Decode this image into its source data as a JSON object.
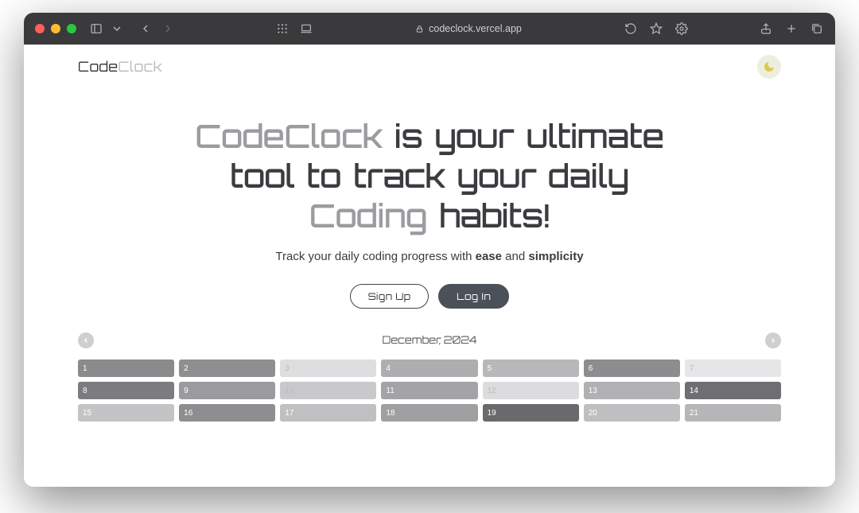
{
  "browser": {
    "url": "codeclock.vercel.app"
  },
  "site": {
    "logo_a": "Code",
    "logo_b": "Clock"
  },
  "hero": {
    "h_part1": "CodeClock",
    "h_part2": " is your ultimate tool to track your daily ",
    "h_part3": "Coding",
    "h_part4": " habits!",
    "sub_a": "Track your daily coding progress with ",
    "sub_b": "ease",
    "sub_c": " and ",
    "sub_d": "simplicity",
    "signup": "Sign Up",
    "login": "Log In"
  },
  "calendar": {
    "title": "December, 2024",
    "cells": [
      {
        "n": "1",
        "bg": "#8b8b8e"
      },
      {
        "n": "2",
        "bg": "#8f8f92"
      },
      {
        "n": "3",
        "bg": "#dedee0"
      },
      {
        "n": "4",
        "bg": "#aeaeb1"
      },
      {
        "n": "5",
        "bg": "#b8b8ba"
      },
      {
        "n": "6",
        "bg": "#8d8d90"
      },
      {
        "n": "7",
        "bg": "#e6e6e8"
      },
      {
        "n": "8",
        "bg": "#7c7c7f"
      },
      {
        "n": "9",
        "bg": "#9b9b9e"
      },
      {
        "n": "10",
        "bg": "#c9c9cb"
      },
      {
        "n": "11",
        "bg": "#a4a4a7"
      },
      {
        "n": "12",
        "bg": "#dcdcde"
      },
      {
        "n": "13",
        "bg": "#b1b1b4"
      },
      {
        "n": "14",
        "bg": "#6f6f72"
      },
      {
        "n": "15",
        "bg": "#c4c4c6"
      },
      {
        "n": "16",
        "bg": "#8e8e91"
      },
      {
        "n": "17",
        "bg": "#c0c0c2"
      },
      {
        "n": "18",
        "bg": "#a0a0a3"
      },
      {
        "n": "19",
        "bg": "#6a6a6d"
      },
      {
        "n": "20",
        "bg": "#bfbfc1"
      },
      {
        "n": "21",
        "bg": "#b6b6b8"
      }
    ]
  }
}
